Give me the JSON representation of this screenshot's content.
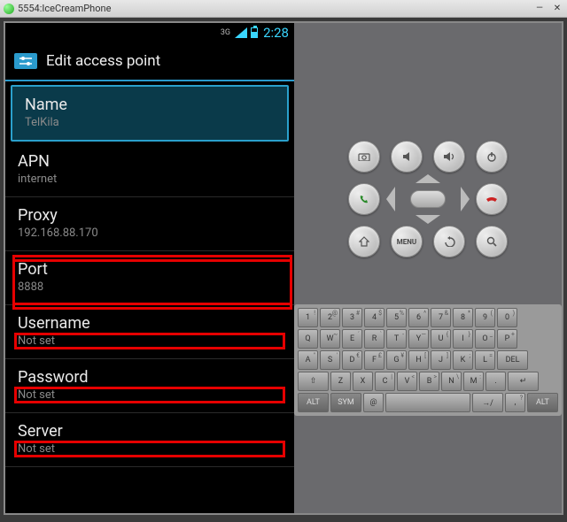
{
  "window": {
    "title": "5554:IceCreamPhone"
  },
  "status": {
    "network_type": "3G",
    "clock": "2:28"
  },
  "header": {
    "title": "Edit access point"
  },
  "items": [
    {
      "label": "Name",
      "value": "TelKila",
      "selected": true,
      "highlight": "none"
    },
    {
      "label": "APN",
      "value": "internet",
      "selected": false,
      "highlight": "none"
    },
    {
      "label": "Proxy",
      "value": "192.168.88.170",
      "selected": false,
      "highlight": "full"
    },
    {
      "label": "Port",
      "value": "8888",
      "selected": false,
      "highlight": "full"
    },
    {
      "label": "Username",
      "value": "Not set",
      "selected": false,
      "highlight": "value"
    },
    {
      "label": "Password",
      "value": "Not set",
      "selected": false,
      "highlight": "value"
    },
    {
      "label": "Server",
      "value": "Not set",
      "selected": false,
      "highlight": "value"
    }
  ],
  "emu_buttons": {
    "row1": [
      "camera",
      "vol-down",
      "vol-up",
      "power"
    ],
    "row2": [
      "call",
      "dpad",
      "end-call"
    ],
    "row3": [
      "home",
      "menu",
      "back",
      "search"
    ],
    "labels": {
      "menu": "MENU"
    }
  },
  "keyboard": {
    "row1": [
      {
        "k": "1",
        "s": "!"
      },
      {
        "k": "2",
        "s": "@"
      },
      {
        "k": "3",
        "s": "#"
      },
      {
        "k": "4",
        "s": "$"
      },
      {
        "k": "5",
        "s": "%"
      },
      {
        "k": "6",
        "s": "^"
      },
      {
        "k": "7",
        "s": "&"
      },
      {
        "k": "8",
        "s": "*"
      },
      {
        "k": "9",
        "s": "("
      },
      {
        "k": "0",
        "s": ")"
      }
    ],
    "row2": [
      {
        "k": "Q"
      },
      {
        "k": "W",
        "s": "~"
      },
      {
        "k": "E",
        "s": "´"
      },
      {
        "k": "R",
        "s": "`"
      },
      {
        "k": "T",
        "s": "-"
      },
      {
        "k": "Y",
        "s": "—"
      },
      {
        "k": "U",
        "s": "{"
      },
      {
        "k": "I",
        "s": "}"
      },
      {
        "k": "O",
        "s": "_"
      },
      {
        "k": "P",
        "s": "+"
      }
    ],
    "row3": [
      {
        "k": "A",
        "s": "\""
      },
      {
        "k": "S",
        "s": "'"
      },
      {
        "k": "D",
        "s": "€"
      },
      {
        "k": "F",
        "s": "£"
      },
      {
        "k": "G",
        "s": "¥"
      },
      {
        "k": "H",
        "s": "["
      },
      {
        "k": "J",
        "s": "]"
      },
      {
        "k": "K",
        "s": ";"
      },
      {
        "k": "L",
        "s": "="
      },
      {
        "k": "DEL",
        "s": "",
        "wide": true
      }
    ],
    "row4": [
      {
        "k": "⇧",
        "wide": true
      },
      {
        "k": "Z"
      },
      {
        "k": "X"
      },
      {
        "k": "C",
        "s": "|"
      },
      {
        "k": "V",
        "s": "<"
      },
      {
        "k": "B",
        "s": ">"
      },
      {
        "k": "N",
        "s": "\\"
      },
      {
        "k": "M",
        "s": ":"
      },
      {
        "k": ".",
        "s": ""
      },
      {
        "k": "↵",
        "wide": true
      }
    ],
    "row5": [
      {
        "k": "ALT",
        "alt": true,
        "wide": true
      },
      {
        "k": "SYM",
        "alt": true,
        "wide": true
      },
      {
        "k": "@"
      },
      {
        "k": "",
        "space": true
      },
      {
        "k": "→/",
        "wide": true
      },
      {
        "k": ",",
        "s": "?"
      },
      {
        "k": "ALT",
        "alt": true,
        "wide": true
      }
    ]
  }
}
